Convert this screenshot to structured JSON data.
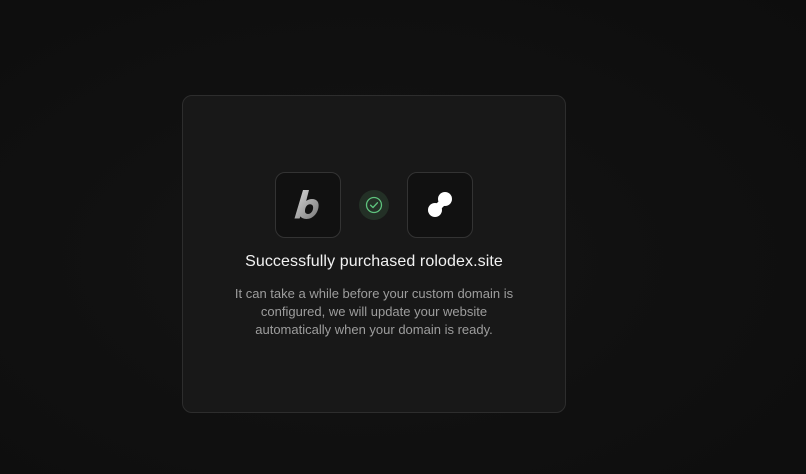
{
  "dialog": {
    "title": "Successfully purchased rolodex.site",
    "description": "It can take a while before your custom domain is configured, we will update your website automatically when your domain is ready."
  },
  "logos": {
    "left": "b-logo-icon",
    "middle": "check-icon",
    "right": "infinity-blob-logo-icon"
  },
  "colors": {
    "background": "#0f0f0f",
    "card": "#181818",
    "success_accent": "#5ec27d"
  }
}
